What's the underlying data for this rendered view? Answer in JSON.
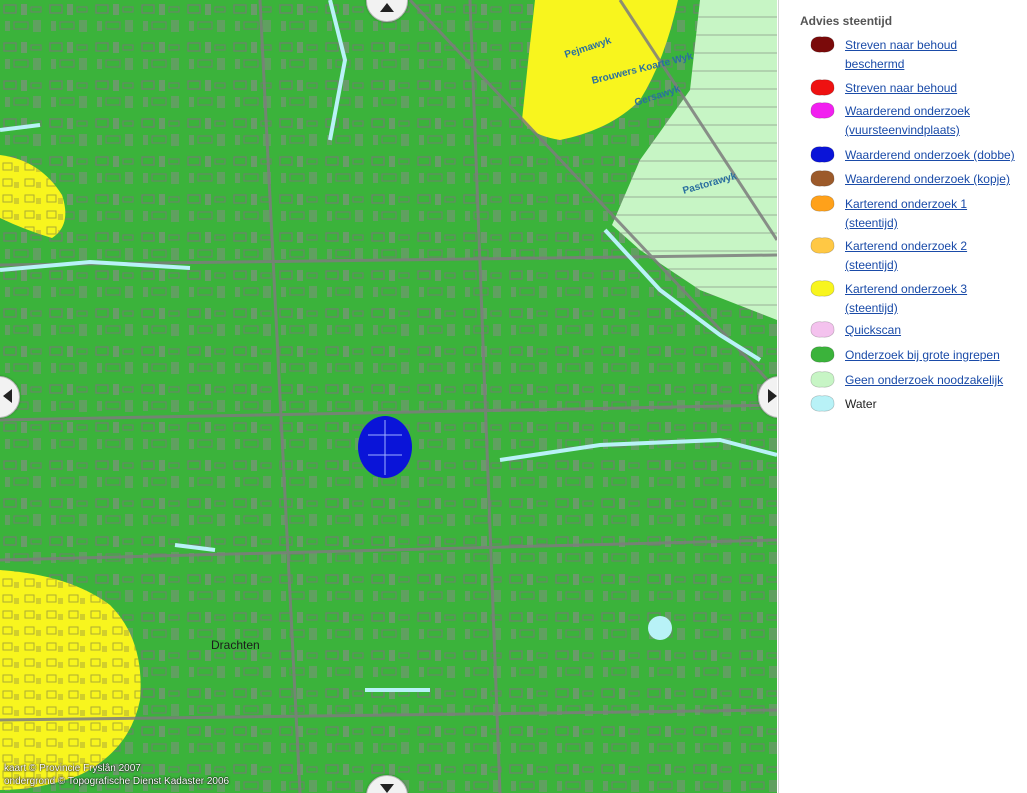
{
  "map": {
    "place_label": "Drachten",
    "streets": [
      "Pejmawyk",
      "Brouwers Koarte Wyk",
      "Gersawyk",
      "Pastorawyk"
    ],
    "copyright_lines": [
      "kaart © Provincie Fryslân 2007",
      "ondergrond © Topografische Dienst Kadaster 2006"
    ],
    "nav_controls": [
      "pan-up",
      "pan-down",
      "pan-left",
      "pan-right"
    ]
  },
  "legend": {
    "title": "Advies steentijd",
    "items": [
      {
        "label": "Streven naar behoud beschermd",
        "lines": [
          "Streven naar behoud",
          "beschermd"
        ],
        "color": "#7a0a0a",
        "link": true
      },
      {
        "label": "Streven naar behoud",
        "lines": [
          "Streven naar behoud"
        ],
        "color": "#ee1111",
        "link": true
      },
      {
        "label": "Waarderend onderzoek (vuursteenvindplaats)",
        "lines": [
          "Waarderend onderzoek",
          "(vuursteenvindplaats)"
        ],
        "color": "#f21ff0",
        "link": true
      },
      {
        "label": "Waarderend onderzoek (dobbe)",
        "lines": [
          "Waarderend onderzoek (dobbe)"
        ],
        "color": "#0a14d8",
        "link": true
      },
      {
        "label": "Waarderend onderzoek (kopje)",
        "lines": [
          "Waarderend onderzoek (kopje)"
        ],
        "color": "#9c5a2a",
        "link": true
      },
      {
        "label": "Karterend onderzoek 1 (steentijd)",
        "lines": [
          "Karterend onderzoek 1",
          "(steentijd)"
        ],
        "color": "#ffa11a",
        "link": true
      },
      {
        "label": "Karterend onderzoek 2 (steentijd)",
        "lines": [
          "Karterend onderzoek 2",
          "(steentijd)"
        ],
        "color": "#ffc844",
        "link": true
      },
      {
        "label": "Karterend onderzoek 3 (steentijd)",
        "lines": [
          "Karterend onderzoek 3",
          "(steentijd)"
        ],
        "color": "#f8f51e",
        "link": true
      },
      {
        "label": "Quickscan",
        "lines": [
          "Quickscan"
        ],
        "color": "#f4c2ee",
        "link": true
      },
      {
        "label": "Onderzoek bij grote ingrepen",
        "lines": [
          "Onderzoek bij grote ingrepen"
        ],
        "color": "#3bb33b",
        "link": true
      },
      {
        "label": "Geen onderzoek noodzakelijk",
        "lines": [
          "Geen onderzoek noodzakelijk"
        ],
        "color": "#c7f5c5",
        "link": true
      },
      {
        "label": "Water",
        "lines": [
          "Water"
        ],
        "color": "#b8f2f7",
        "link": false
      }
    ]
  }
}
